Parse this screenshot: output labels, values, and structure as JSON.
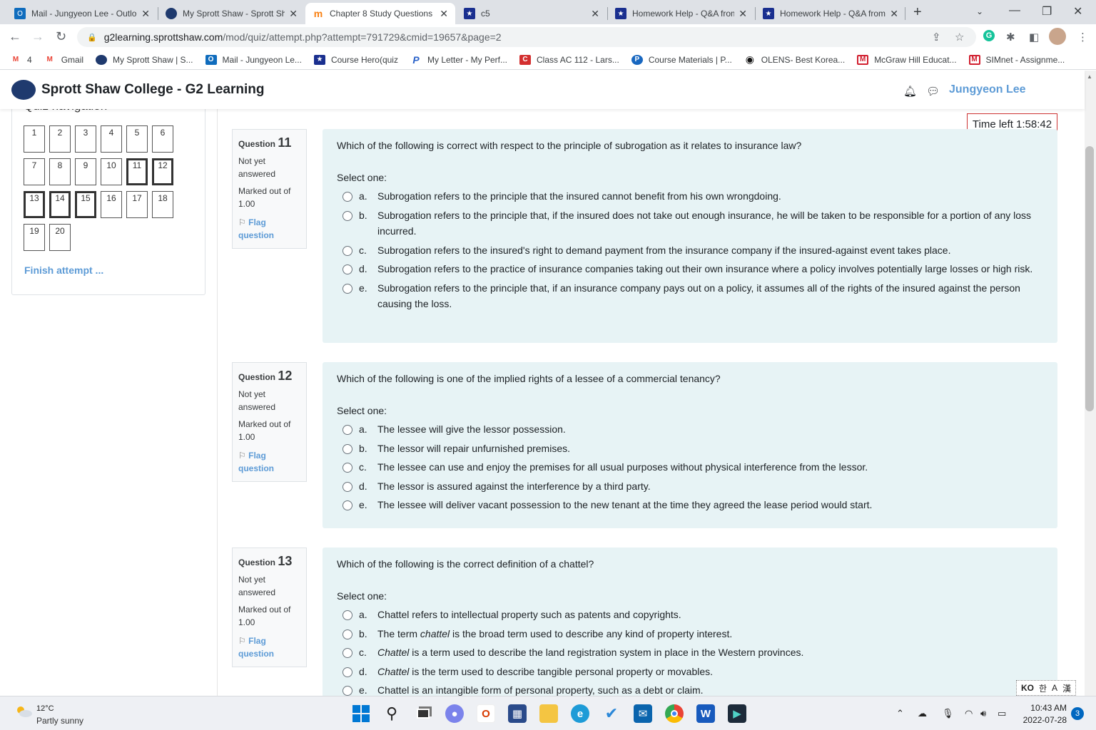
{
  "browser": {
    "tabs": [
      {
        "title": "Mail - Jungyeon Lee - Outlo",
        "favicon": "outlook-icon",
        "color": "#0f6cbd",
        "glyph": "O"
      },
      {
        "title": "My Sprott Shaw - Sprott Sh",
        "favicon": "sprott-icon",
        "color": "#1f3a6e",
        "glyph": ""
      },
      {
        "title": "Chapter 8 Study Questions",
        "favicon": "moodle-icon",
        "color": "#f98012",
        "glyph": "m"
      },
      {
        "title": "c5",
        "favicon": "coursehero-icon",
        "color": "#1a2f8f",
        "glyph": "★"
      },
      {
        "title": "Homework Help - Q&A from",
        "favicon": "coursehero-icon",
        "color": "#1a2f8f",
        "glyph": "★"
      },
      {
        "title": "Homework Help - Q&A from",
        "favicon": "coursehero-icon",
        "color": "#1a2f8f",
        "glyph": "★"
      }
    ],
    "url_host": "g2learning.sprottshaw.com",
    "url_path": "/mod/quiz/attempt.php?attempt=791729&cmid=19657&page=2",
    "bookmarks": [
      {
        "label": "4",
        "icon": "gmail-icon",
        "color": "#ea4335",
        "glyph": "M"
      },
      {
        "label": "Gmail",
        "icon": "gmail-icon",
        "color": "#ea4335",
        "glyph": "M"
      },
      {
        "label": "My Sprott Shaw | S...",
        "icon": "sprott-icon",
        "color": "#1f3a6e",
        "glyph": ""
      },
      {
        "label": "Mail - Jungyeon Le...",
        "icon": "outlook-icon",
        "color": "#0f6cbd",
        "glyph": "O"
      },
      {
        "label": "Course Hero(quiz",
        "icon": "coursehero-icon",
        "color": "#1a2f8f",
        "glyph": "★"
      },
      {
        "label": "My Letter - My Perf...",
        "icon": "p-icon",
        "color": "#2b62c9",
        "glyph": "P"
      },
      {
        "label": "Class AC 112 - Lars...",
        "icon": "class-icon",
        "color": "#d32f2f",
        "glyph": "C"
      },
      {
        "label": "Course Materials | P...",
        "icon": "pearson-icon",
        "color": "#1867c0",
        "glyph": "P"
      },
      {
        "label": "OLENS- Best Korea...",
        "icon": "olens-icon",
        "color": "#111111",
        "glyph": "●"
      },
      {
        "label": "McGraw Hill Educat...",
        "icon": "mcgraw-icon",
        "color": "#d11f2f",
        "glyph": "M"
      },
      {
        "label": "SIMnet - Assignme...",
        "icon": "simnet-icon",
        "color": "#d11f2f",
        "glyph": "M"
      }
    ]
  },
  "site": {
    "title": "Sprott Shaw College - G2 Learning",
    "user": "Jungyeon Lee",
    "accent": "#5d9bd6"
  },
  "quiz_nav": {
    "title": "Quiz navigation",
    "buttons": [
      "1",
      "2",
      "3",
      "4",
      "5",
      "6",
      "7",
      "8",
      "9",
      "10",
      "11",
      "12",
      "13",
      "14",
      "15",
      "16",
      "17",
      "18",
      "19",
      "20"
    ],
    "current": [
      "11",
      "12",
      "13",
      "14",
      "15"
    ],
    "finish": "Finish attempt ..."
  },
  "timer": "Time left 1:58:42",
  "questions": [
    {
      "label": "Question",
      "number": "11",
      "state": "Not yet answered",
      "grade": "Marked out of 1.00",
      "flag": "Flag question",
      "text": "Which of the following is correct with respect to the principle of subrogation as it relates to insurance law?",
      "prompt": "Select one:",
      "options": [
        {
          "letter": "a.",
          "text": "Subrogation refers to the principle that the insured cannot benefit from his own wrongdoing."
        },
        {
          "letter": "b.",
          "text": "Subrogation refers to the principle that, if the insured does not take out enough insurance, he will be taken to be responsible for a portion of any loss incurred."
        },
        {
          "letter": "c.",
          "text": "Subrogation refers to the insured's right to demand payment from the insurance company if the insured-against event takes place."
        },
        {
          "letter": "d.",
          "text": "Subrogation refers to the practice of insurance companies taking out their own insurance where a policy involves potentially large losses or high risk."
        },
        {
          "letter": "e.",
          "text": "Subrogation refers to the principle that, if an insurance company pays out on a policy, it assumes all of the rights of the insured against the person causing the loss."
        }
      ]
    },
    {
      "label": "Question",
      "number": "12",
      "state": "Not yet answered",
      "grade": "Marked out of 1.00",
      "flag": "Flag question",
      "text": "Which of the following is one of the implied rights of a lessee of a commercial tenancy?",
      "prompt": "Select one:",
      "options": [
        {
          "letter": "a.",
          "text": "The lessee will give the lessor possession."
        },
        {
          "letter": "b.",
          "text": "The lessor will repair unfurnished premises."
        },
        {
          "letter": "c.",
          "text": "The lessee can use and enjoy the premises for all usual purposes without physical interference from the lessor."
        },
        {
          "letter": "d.",
          "text": "The lessor is assured against the interference by a third party."
        },
        {
          "letter": "e.",
          "text": "The lessee will deliver vacant possession to the new tenant at the time they agreed the lease period would start."
        }
      ]
    },
    {
      "label": "Question",
      "number": "13",
      "state": "Not yet answered",
      "grade": "Marked out of 1.00",
      "flag": "Flag question",
      "text": "Which of the following is the correct definition of a chattel?",
      "prompt": "Select one:",
      "options": [
        {
          "letter": "a.",
          "text": "Chattel refers to intellectual property such as patents and copyrights."
        },
        {
          "letter": "b.",
          "pre": "The term ",
          "em": "chattel",
          "post": " is the broad term used to describe any kind of property interest."
        },
        {
          "letter": "c.",
          "pre": "",
          "em": "Chattel",
          "post": " is a term used to describe the land registration system in place in the Western provinces."
        },
        {
          "letter": "d.",
          "pre": "",
          "em": "Chattel",
          "post": " is the term used to describe tangible personal property or movables."
        },
        {
          "letter": "e.",
          "text": "Chattel is an intangible form of personal property, such as a debt or claim."
        }
      ]
    }
  ],
  "taskbar": {
    "temp": "12°C",
    "weather": "Partly sunny",
    "time": "10:43 AM",
    "date": "2022-07-28",
    "notifications": "3",
    "ime": [
      "KO",
      "한",
      "A",
      "漢"
    ]
  }
}
